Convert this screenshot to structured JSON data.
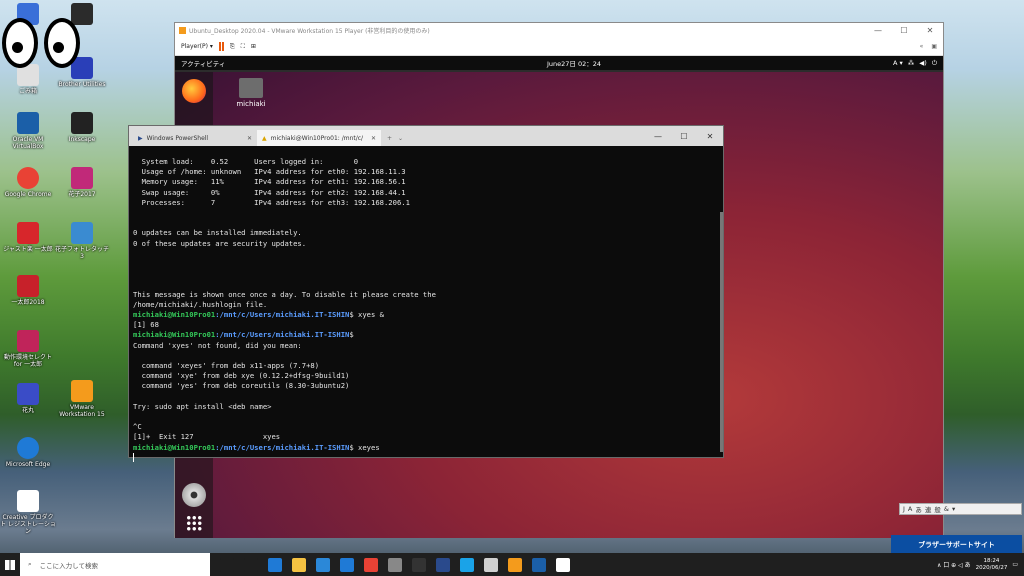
{
  "desktop": {
    "icons": [
      {
        "label": "",
        "color": "#3a6fd8"
      },
      {
        "label": "ごみ箱",
        "color": "#e0e0e0"
      },
      {
        "label": "Oracle VM VirtualBox",
        "color": "#1b5fa8"
      },
      {
        "label": "Google Chrome",
        "color": "#e94235"
      },
      {
        "label": "ジャスト楽 一太郎",
        "color": "#d7262b"
      },
      {
        "label": "一太郎2018",
        "color": "#c7212a"
      },
      {
        "label": "動作環境セレクト for 一太郎",
        "color": "#c0245a"
      },
      {
        "label": "花丸",
        "color": "#3a4cc7"
      },
      {
        "label": "Microsoft Edge",
        "color": "#1f7ad6"
      },
      {
        "label": "Creative プロダクト レジストレーション",
        "color": "#ffffff"
      },
      {
        "label": "Rectangle",
        "color": "#2b2b2b"
      },
      {
        "label": "Brother Utilities",
        "color": "#2a3fb8"
      },
      {
        "label": "Inkscape",
        "color": "#222222"
      },
      {
        "label": "花子2017",
        "color": "#c12979"
      },
      {
        "label": "花子フォトレタッチ3",
        "color": "#3a8bd1"
      },
      {
        "label": "VMware Workstation 15",
        "color": "#f49b1c"
      }
    ]
  },
  "vmware": {
    "title": "Ubuntu_Desktop 2020.04 - VMware Workstation 15 Player (非営利目的の使用のみ)",
    "menu": "Player(P) ▾",
    "controls": [
      "—",
      "☐",
      "✕"
    ]
  },
  "ubuntu": {
    "activities": "アクティビティ",
    "clock": "June27日 02：24",
    "input": "A ▾",
    "home_label": "michiaki"
  },
  "terminal": {
    "tab1": "Windows PowerShell",
    "tab2": "michiaki@Win10Pro01: /mnt/c/",
    "controls": [
      "—",
      "☐",
      "✕"
    ],
    "lines": [
      {
        "t": "  System load:    0.52      Users logged in:       0"
      },
      {
        "t": "  Usage of /home: unknown   IPv4 address for eth0: 192.168.11.3"
      },
      {
        "t": "  Memory usage:   11%       IPv4 address for eth1: 192.168.56.1"
      },
      {
        "t": "  Swap usage:     0%        IPv4 address for eth2: 192.168.44.1"
      },
      {
        "t": "  Processes:      7         IPv4 address for eth3: 192.168.206.1"
      },
      {
        "t": ""
      },
      {
        "t": ""
      },
      {
        "t": "0 updates can be installed immediately."
      },
      {
        "t": "0 of these updates are security updates."
      },
      {
        "t": ""
      },
      {
        "t": ""
      },
      {
        "t": ""
      },
      {
        "t": ""
      },
      {
        "t": "This message is shown once once a day. To disable it please create the"
      },
      {
        "t": "/home/michiaki/.hushlogin file."
      },
      {
        "user": "michiaki@Win10Pro01",
        "path": ":/mnt/c/Users/michiaki.IT-ISHIN",
        "cmd": "$ xyes &"
      },
      {
        "t": "[1] 68"
      },
      {
        "user": "michiaki@Win10Pro01",
        "path": ":/mnt/c/Users/michiaki.IT-ISHIN",
        "cmd": "$"
      },
      {
        "t": "Command 'xyes' not found, did you mean:"
      },
      {
        "t": ""
      },
      {
        "t": "  command 'xeyes' from deb x11-apps (7.7+8)"
      },
      {
        "t": "  command 'xye' from deb xye (0.12.2+dfsg-9build1)"
      },
      {
        "t": "  command 'yes' from deb coreutils (8.30-3ubuntu2)"
      },
      {
        "t": ""
      },
      {
        "t": "Try: sudo apt install <deb name>"
      },
      {
        "t": ""
      },
      {
        "t": "^C"
      },
      {
        "t": "[1]+  Exit 127                xyes"
      },
      {
        "user": "michiaki@Win10Pro01",
        "path": ":/mnt/c/Users/michiaki.IT-ISHIN",
        "cmd": "$ xeyes"
      }
    ]
  },
  "ime": {
    "items": [
      "J",
      "A",
      "あ",
      "連",
      "般",
      "&",
      "▾"
    ]
  },
  "brother": {
    "label": "ブラザーサポートサイト"
  },
  "taskbar": {
    "search_placeholder": "ここに入力して検索",
    "icons": [
      {
        "name": "cortana-icon",
        "color": "#1f1f1f"
      },
      {
        "name": "task-view-icon",
        "color": "#1f1f1f"
      },
      {
        "name": "edge-icon",
        "color": "#1f7ad6"
      },
      {
        "name": "explorer-icon",
        "color": "#f5c242"
      },
      {
        "name": "store-icon",
        "color": "#2b88d8"
      },
      {
        "name": "mail-icon",
        "color": "#1f7ad6"
      },
      {
        "name": "chrome-icon",
        "color": "#e94235"
      },
      {
        "name": "app-icon",
        "color": "#888888"
      },
      {
        "name": "terminal-icon",
        "color": "#333333"
      },
      {
        "name": "powershell-icon",
        "color": "#2a4a8c"
      },
      {
        "name": "x-icon",
        "color": "#1aa3e8"
      },
      {
        "name": "paint-icon",
        "color": "#d0d0d0"
      },
      {
        "name": "vmware-icon",
        "color": "#f49b1c"
      },
      {
        "name": "virtualbox-icon",
        "color": "#1b5fa8"
      },
      {
        "name": "eyes-icon",
        "color": "#ffffff"
      }
    ],
    "time": "18:24",
    "date": "2020/06/27",
    "tray": "∧ 口 ⊕ ◁ あ"
  }
}
